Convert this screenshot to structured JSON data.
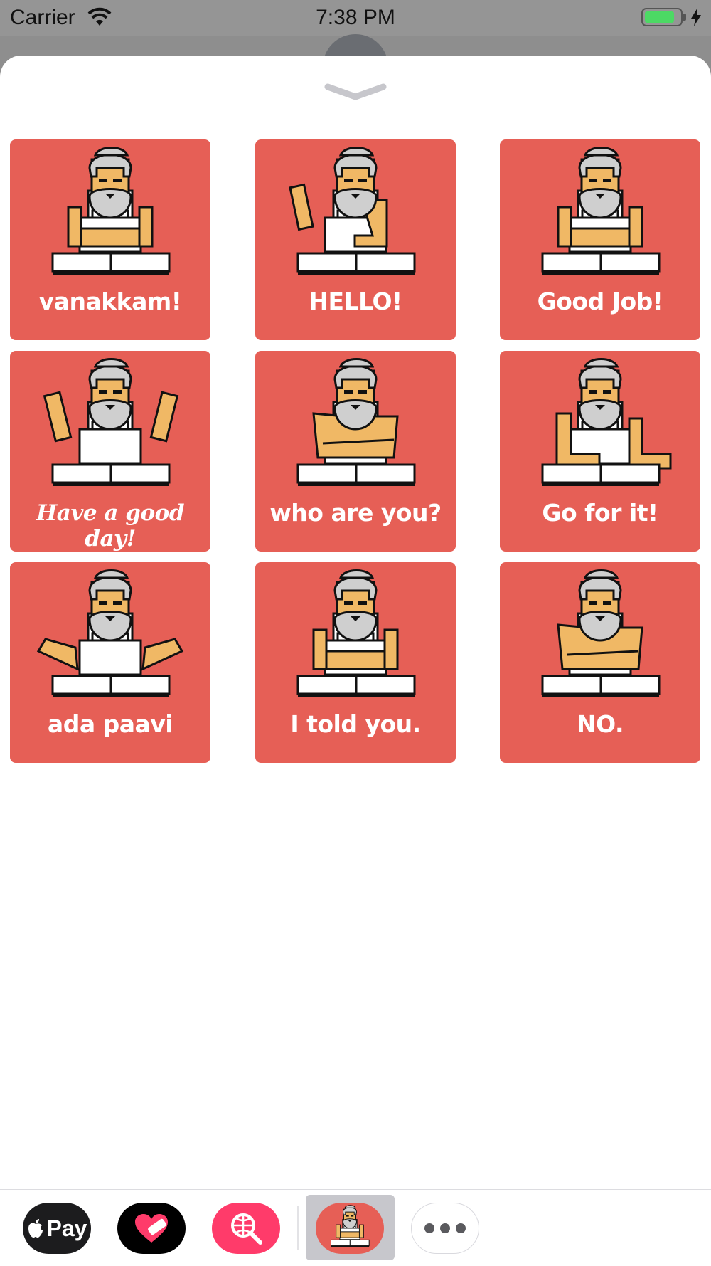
{
  "status_bar": {
    "carrier": "Carrier",
    "time": "7:38 PM",
    "battery_level": 0.85,
    "battery_color": "#4cd964",
    "wifi_icon": "wifi-icon",
    "charging_icon": "bolt-icon"
  },
  "sheet": {
    "collapse_icon": "chevron-down-icon"
  },
  "stickers": [
    {
      "label": "vanakkam!",
      "pose": "arms-folded-low"
    },
    {
      "label": "HELLO!",
      "pose": "wave"
    },
    {
      "label": "Good Job!",
      "pose": "arms-folded-low"
    },
    {
      "label": "Have a good day!",
      "pose": "both-arms-up"
    },
    {
      "label": "who are you?",
      "pose": "arms-crossed"
    },
    {
      "label": "Go for it!",
      "pose": "arm-out"
    },
    {
      "label": "ada paavi",
      "pose": "arms-spread"
    },
    {
      "label": "I told you.",
      "pose": "arms-folded-low"
    },
    {
      "label": "NO.",
      "pose": "arms-crossed"
    }
  ],
  "colors": {
    "tile": "#e65f56",
    "skin": "#f0b865",
    "hair": "#cfcfcf",
    "app_search": "#ff3b6a"
  },
  "drawer": {
    "apps": [
      {
        "name": "apple-pay",
        "label": "Pay",
        "icon": "apple-icon"
      },
      {
        "name": "heart-app",
        "icon": "heart-icon"
      },
      {
        "name": "web-search-app",
        "icon": "globe-search-icon"
      },
      {
        "name": "sticker-app",
        "icon": "old-man-sticker-icon",
        "selected": true
      },
      {
        "name": "more-apps",
        "icon": "more-icon"
      }
    ]
  }
}
